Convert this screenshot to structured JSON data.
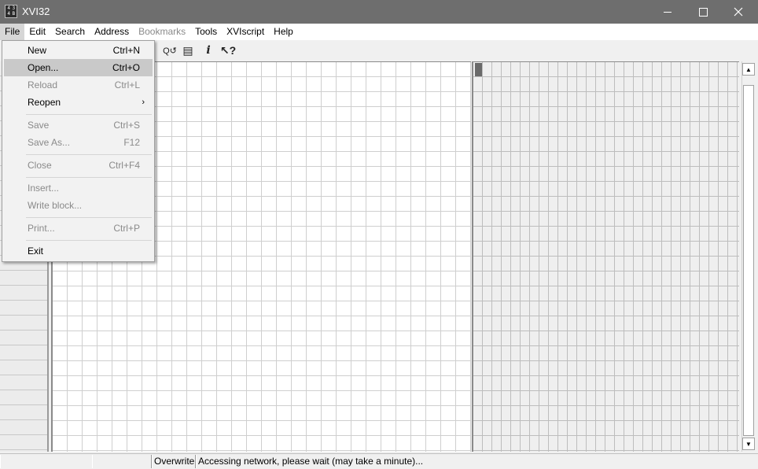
{
  "window": {
    "title": "XVI32",
    "app_icon_text": "4 3\n4 B"
  },
  "menubar": [
    {
      "label": "File",
      "state": "active"
    },
    {
      "label": "Edit",
      "state": "normal"
    },
    {
      "label": "Search",
      "state": "normal"
    },
    {
      "label": "Address",
      "state": "normal"
    },
    {
      "label": "Bookmarks",
      "state": "disabled"
    },
    {
      "label": "Tools",
      "state": "normal"
    },
    {
      "label": "XVIscript",
      "state": "normal"
    },
    {
      "label": "Help",
      "state": "normal"
    }
  ],
  "toolbar": {
    "buttons": [
      {
        "name": "find-replace-icon",
        "glyph": "Q↺"
      },
      {
        "name": "properties-icon",
        "glyph": "▤"
      },
      {
        "name": "info-icon",
        "glyph": "i"
      },
      {
        "name": "context-help-icon",
        "glyph": "↖?"
      }
    ]
  },
  "file_menu": {
    "items": [
      {
        "label": "New",
        "shortcut": "Ctrl+N",
        "enabled": true,
        "highlight": false
      },
      {
        "label": "Open...",
        "shortcut": "Ctrl+O",
        "enabled": true,
        "highlight": true
      },
      {
        "label": "Reload",
        "shortcut": "Ctrl+L",
        "enabled": false,
        "highlight": false
      },
      {
        "label": "Reopen",
        "shortcut": "",
        "submenu": true,
        "enabled": true,
        "highlight": false
      },
      {
        "label": "Save",
        "shortcut": "Ctrl+S",
        "enabled": false,
        "highlight": false
      },
      {
        "label": "Save As...",
        "shortcut": "F12",
        "enabled": false,
        "highlight": false
      },
      {
        "label": "Close",
        "shortcut": "Ctrl+F4",
        "enabled": false,
        "highlight": false
      },
      {
        "label": "Insert...",
        "shortcut": "",
        "enabled": false,
        "highlight": false
      },
      {
        "label": "Write block...",
        "shortcut": "",
        "enabled": false,
        "highlight": false
      },
      {
        "label": "Print...",
        "shortcut": "Ctrl+P",
        "enabled": false,
        "highlight": false
      },
      {
        "label": "Exit",
        "shortcut": "",
        "enabled": true,
        "highlight": false
      }
    ]
  },
  "statusbar": {
    "panel1": "",
    "panel2": "",
    "mode": "Overwrite",
    "message": "Accessing network, please wait (may take a minute)..."
  },
  "scrollbar": {
    "up_glyph": "▲",
    "down_glyph": "▼"
  },
  "colors": {
    "titlebar": "#6e6e6e",
    "menu_highlight": "#c9c9c9",
    "disabled_text": "#8a8a8a"
  }
}
